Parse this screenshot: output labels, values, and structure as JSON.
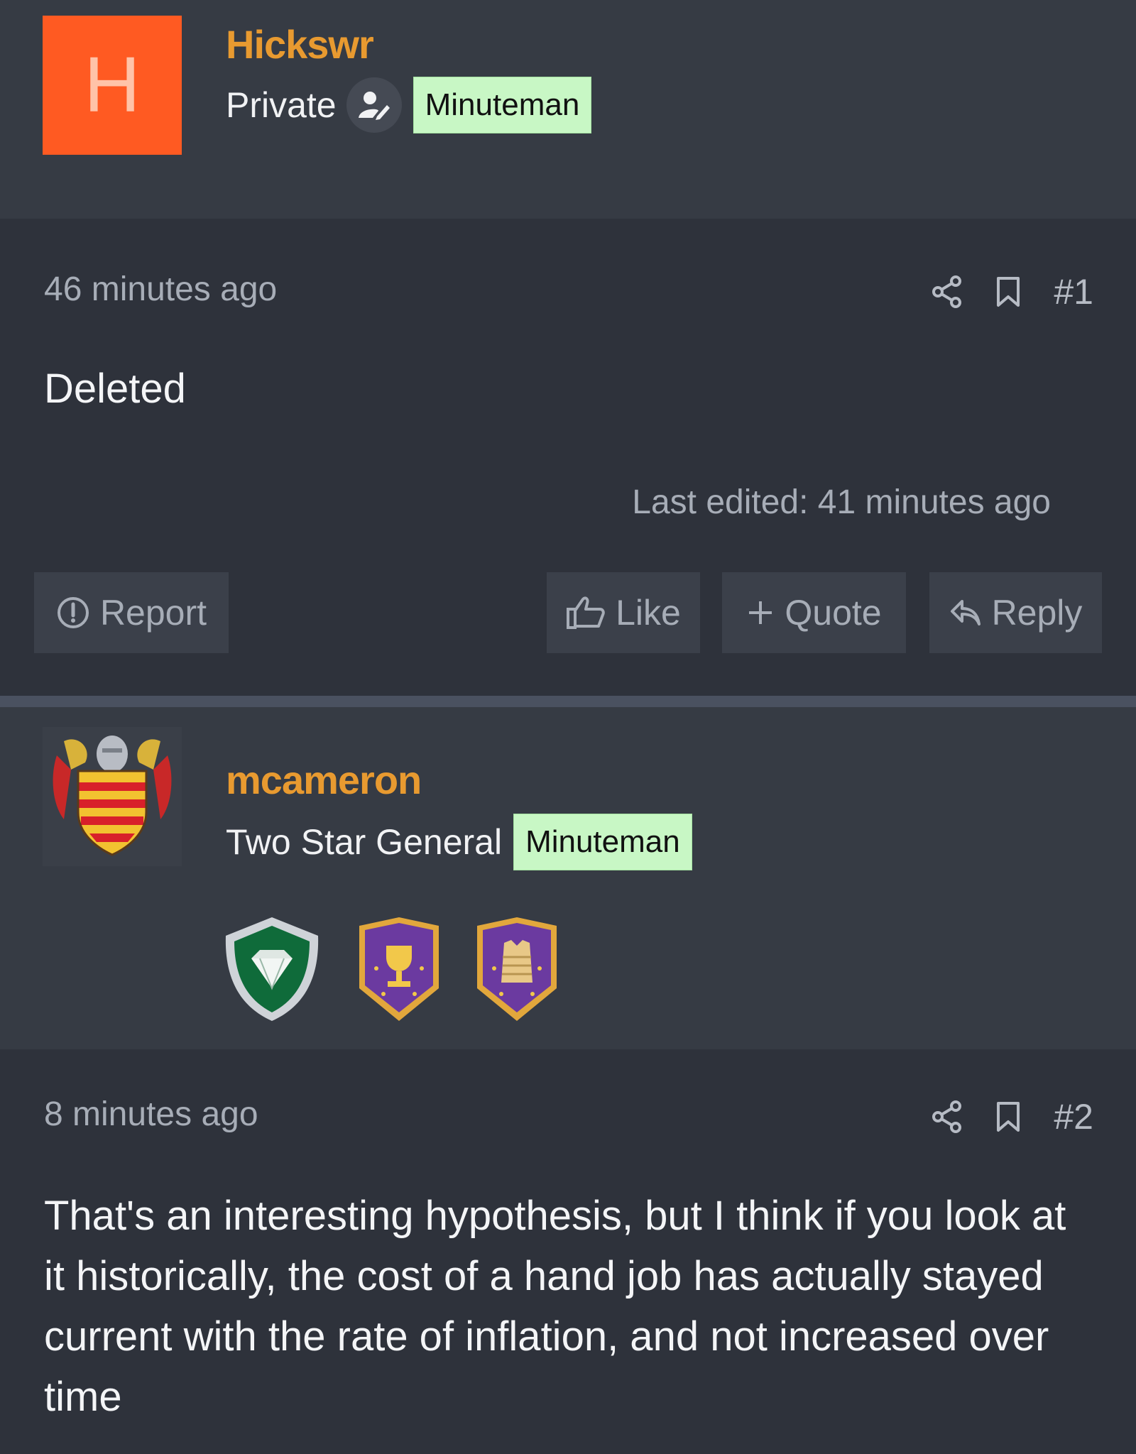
{
  "posts": [
    {
      "author": {
        "avatar_letter": "H",
        "avatar_color": "#ff5a22",
        "username": "Hickswr",
        "rank": "Private",
        "tag": "Minuteman"
      },
      "time": "46 minutes ago",
      "number": "#1",
      "content": "Deleted",
      "last_edited": "Last edited: 41 minutes ago",
      "actions": {
        "report": "Report",
        "like": "Like",
        "quote": "Quote",
        "reply": "Reply"
      }
    },
    {
      "author": {
        "username": "mcameron",
        "rank": "Two Star General",
        "tag": "Minuteman",
        "badges": [
          "emerald-shield-badge",
          "trophy-shield-badge",
          "armor-vest-shield-badge"
        ]
      },
      "time": "8 minutes ago",
      "number": "#2",
      "content": "That's an interesting hypothesis, but I think if you look at it historically, the cost of a hand job has actually stayed current with the rate of inflation, and not increased over time"
    }
  ],
  "colors": {
    "username": "#e89a30",
    "tag_bg": "#c8f7c5",
    "header_bg": "#363b44",
    "post_bg": "#2e323b"
  }
}
